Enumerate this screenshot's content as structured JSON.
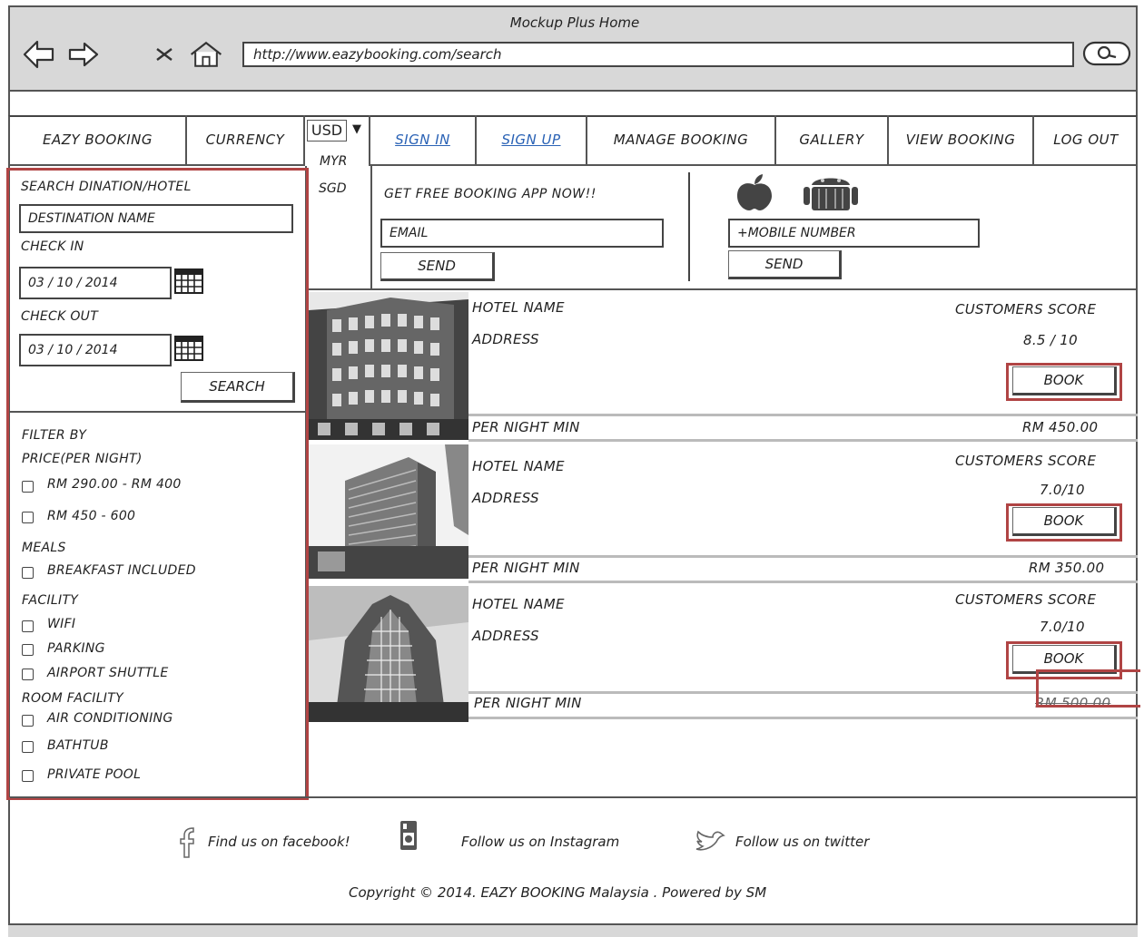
{
  "window": {
    "title": "Mockup Plus Home"
  },
  "browser": {
    "url": "http://www.eazybooking.com/search"
  },
  "nav": {
    "brand": "EAZY BOOKING",
    "currency_label": "CURRENCY",
    "currency_selected": "USD",
    "currency_options": [
      "MYR",
      "SGD"
    ],
    "sign_in": "SIGN IN",
    "sign_up": "SIGN UP",
    "manage_booking": "MANAGE BOOKING",
    "gallery": "GALLERY",
    "view_booking": "VIEW BOOKING",
    "log_out": "LOG OUT"
  },
  "promo": {
    "text": "GET FREE BOOKING APP NOW!!",
    "email_placeholder": "EMAIL",
    "send_label": "SEND",
    "mobile_placeholder": "+MOBILE NUMBER",
    "mobile_send_label": "SEND"
  },
  "search": {
    "heading": "SEARCH DINATION/HOTEL",
    "destination_placeholder": "DESTINATION NAME",
    "check_in_label": "CHECK IN",
    "check_in_value": "03 / 10 / 2014",
    "check_out_label": "CHECK OUT",
    "check_out_value": "03 / 10 / 2014",
    "search_label": "SEARCH"
  },
  "filters": {
    "heading": "FILTER BY",
    "price_heading": "PRICE(PER NIGHT)",
    "price_options": [
      "RM 290.00 - RM 400",
      "RM 450 - 600"
    ],
    "meals_heading": "MEALS",
    "meals_options": [
      "BREAKFAST INCLUDED"
    ],
    "facility_heading": "FACILITY",
    "facility_options": [
      "WIFI",
      "PARKING",
      "AIRPORT SHUTTLE"
    ],
    "room_heading": "ROOM FACILITY",
    "room_options": [
      "AIR CONDITIONING",
      "BATHTUB",
      "PRIVATE POOL"
    ]
  },
  "hotels": [
    {
      "name": "HOTEL NAME",
      "address": "ADDRESS",
      "score_label": "CUSTOMERS SCORE",
      "score": "8.5 / 10",
      "book_label": "BOOK",
      "price_label": "PER NIGHT MIN",
      "price": "RM 450.00"
    },
    {
      "name": "HOTEL NAME",
      "address": "ADDRESS",
      "score_label": "CUSTOMERS SCORE",
      "score": "7.0/10",
      "book_label": "BOOK",
      "price_label": "PER NIGHT MIN",
      "price": "RM 350.00"
    },
    {
      "name": "HOTEL NAME",
      "address": "ADDRESS",
      "score_label": "CUSTOMERS SCORE",
      "score": "7.0/10",
      "book_label": "BOOK",
      "price_label": "PER NIGHT MIN",
      "price": "RM 500.00"
    }
  ],
  "footer": {
    "facebook": "Find us on facebook!",
    "instagram": "Follow us on Instagram",
    "twitter": "Follow us on twitter",
    "copyright": "Copyright © 2014. EAZY BOOKING Malaysia . Powered by SM"
  }
}
